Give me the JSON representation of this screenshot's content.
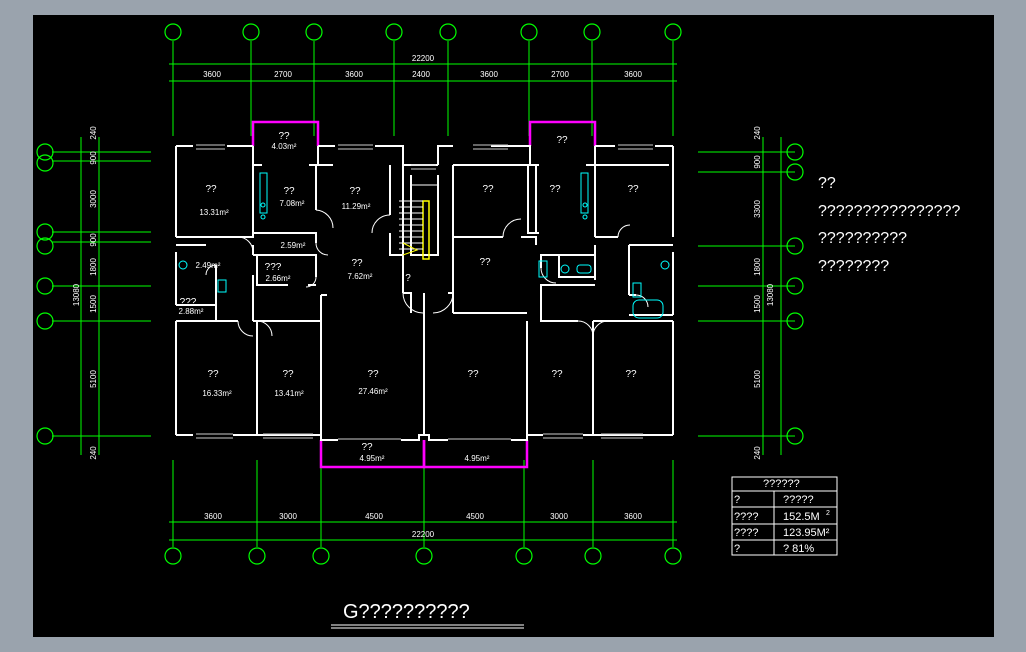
{
  "colors": {
    "background": "#000000",
    "frame": "#9aa3ad",
    "dimension_lines": "#00ff00",
    "axis_circles": "#00ff00",
    "walls": "#ffffff",
    "balcony_outline": "#ff00ff",
    "text": "#ffffff",
    "fixtures": "#00ffff",
    "stairs": "#ffff00"
  },
  "top_dimensions": {
    "overall": "22200",
    "segments": [
      "3600",
      "2700",
      "3600",
      "2400",
      "3600",
      "2700",
      "3600"
    ]
  },
  "bottom_dimensions": {
    "overall": "22200",
    "segments": [
      "3600",
      "3000",
      "4500",
      "4500",
      "3000",
      "3600"
    ]
  },
  "left_dimensions": {
    "overall": "13080",
    "segments": [
      "240",
      "900",
      "3000",
      "900",
      "1800",
      "1500",
      "5100",
      "240"
    ]
  },
  "right_dimensions": {
    "overall": "13080",
    "segments": [
      "240",
      "900",
      "3300",
      "1800",
      "1500",
      "5100",
      "240"
    ]
  },
  "rooms": {
    "north_balcony_left": {
      "name": "??",
      "area": "4.03m²"
    },
    "north_balcony_right": {
      "name": "??"
    },
    "bedroom_nw": {
      "name": "??",
      "area": "13.31m²"
    },
    "kitchen_left": {
      "name": "??",
      "area": "7.08m²"
    },
    "bedroom_north_left": {
      "name": "??",
      "area": "11.29m²"
    },
    "hall_left": {
      "area": "2.59m²"
    },
    "bath_left": {
      "area": "2.49m²"
    },
    "closet_left": {
      "name": "???",
      "area": "2.66m²"
    },
    "dining_left": {
      "name": "??",
      "area": "7.62m²"
    },
    "storage_left": {
      "name": "???",
      "area": "2.88m²"
    },
    "stair_label": "?",
    "bedroom_north_right": {
      "name": "??"
    },
    "kitchen_right": {
      "name": "??"
    },
    "bedroom_ne": {
      "name": "??"
    },
    "dining_right": {
      "name": "??"
    },
    "bedroom_sw": {
      "name": "??",
      "area": "16.33m²"
    },
    "bedroom_south_left": {
      "name": "??",
      "area": "13.41m²"
    },
    "living_left": {
      "name": "??",
      "area": "27.46m²"
    },
    "living_right": {
      "name": "??"
    },
    "bedroom_south_right": {
      "name": "??"
    },
    "bedroom_se": {
      "name": "??"
    },
    "south_balcony_left": {
      "name": "??",
      "area": "4.95m²"
    },
    "south_balcony_right": {
      "area": "4.95m²"
    }
  },
  "notes": [
    "??",
    "????????????????",
    "??????????",
    "????????"
  ],
  "area_table": {
    "title": "??????",
    "rows": [
      {
        "label": "?",
        "value": "?????"
      },
      {
        "label": "????",
        "value": "152.5M",
        "sup": "2"
      },
      {
        "label": "????",
        "value": "123.95M²"
      },
      {
        "label": "?",
        "value": "?  81%"
      }
    ]
  },
  "drawing_title": "G??????????"
}
